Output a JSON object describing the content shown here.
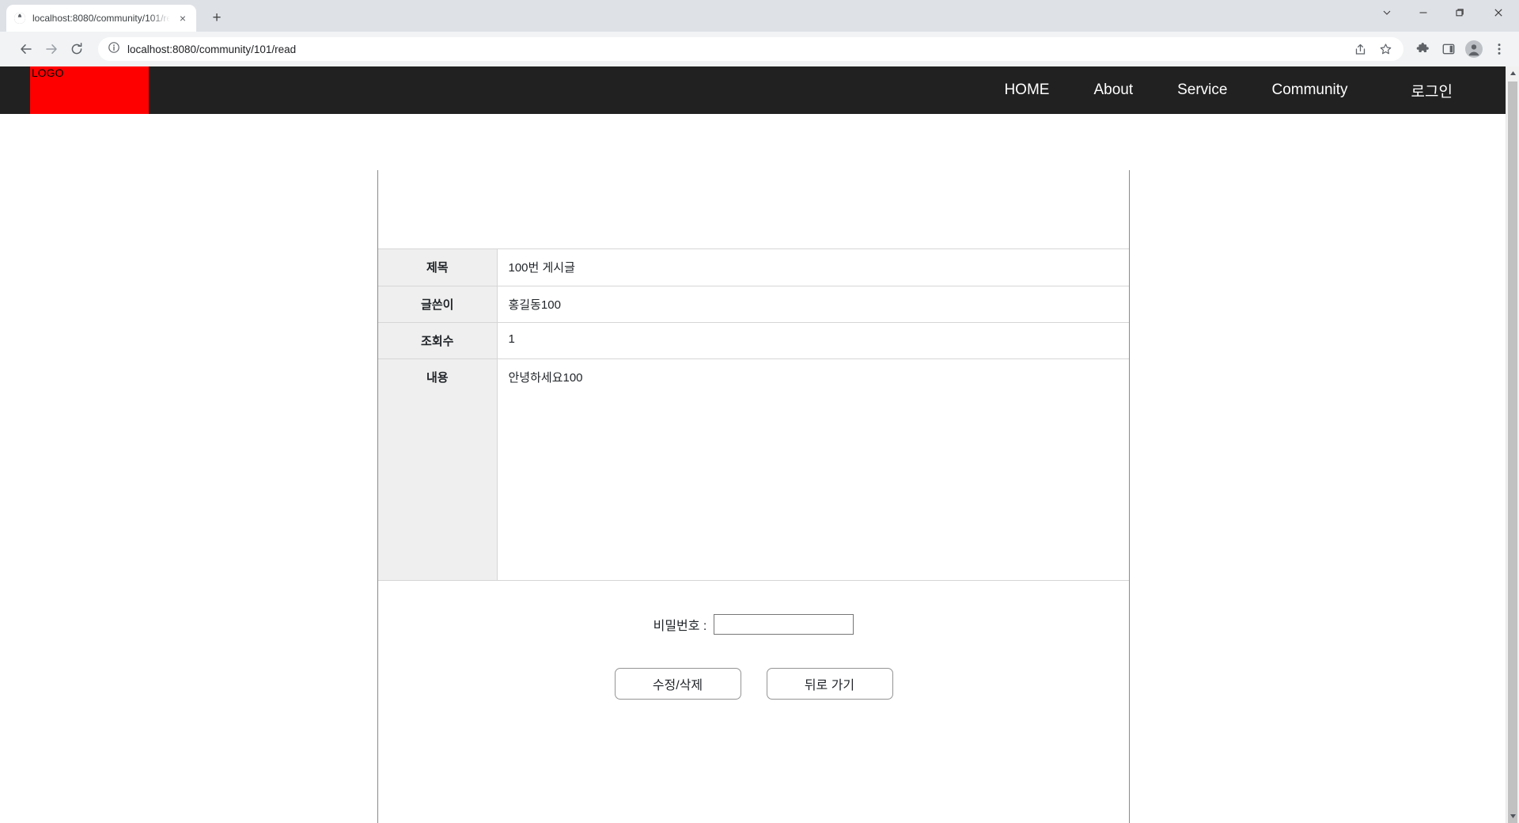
{
  "browser": {
    "tab": {
      "title": "localhost:8080/community/101/read",
      "favicon": "globe-icon",
      "close": "×"
    },
    "new_tab_label": "+",
    "window_controls": {
      "minimize_more": "⌄",
      "minimize": "—",
      "maximize": "❐",
      "close": "×"
    },
    "nav": {
      "back": "←",
      "forward": "→",
      "reload": "⟳"
    },
    "omnibox": {
      "security_icon": "info-circle-icon",
      "url": "localhost:8080/community/101/read",
      "placeholder": "Search Google or type a URL"
    },
    "toolbar_icons": [
      {
        "name": "share-icon"
      },
      {
        "name": "bookmark-star-icon"
      },
      {
        "name": "extensions-puzzle-icon"
      },
      {
        "name": "side-panel-icon"
      },
      {
        "name": "profile-avatar-icon"
      },
      {
        "name": "more-menu-icon"
      }
    ]
  },
  "site": {
    "logo_text": "LOGO",
    "logo_color": "#ff0000",
    "navbar_color": "#212121",
    "nav_links": [
      {
        "label": "HOME"
      },
      {
        "label": "About"
      },
      {
        "label": "Service"
      },
      {
        "label": "Community"
      },
      {
        "label": "로그인"
      }
    ]
  },
  "post": {
    "rows": [
      {
        "label": "제목",
        "value": "100번 게시글"
      },
      {
        "label": "글쓴이",
        "value": "홍길동100"
      },
      {
        "label": "조회수",
        "value": "1"
      },
      {
        "label": "내용",
        "value": "안녕하세요100"
      }
    ]
  },
  "form": {
    "password_label": "비밀번호 :",
    "password_value": "",
    "password_placeholder": "",
    "edit_delete_button": "수정/삭제",
    "back_button": "뒤로 가기"
  }
}
